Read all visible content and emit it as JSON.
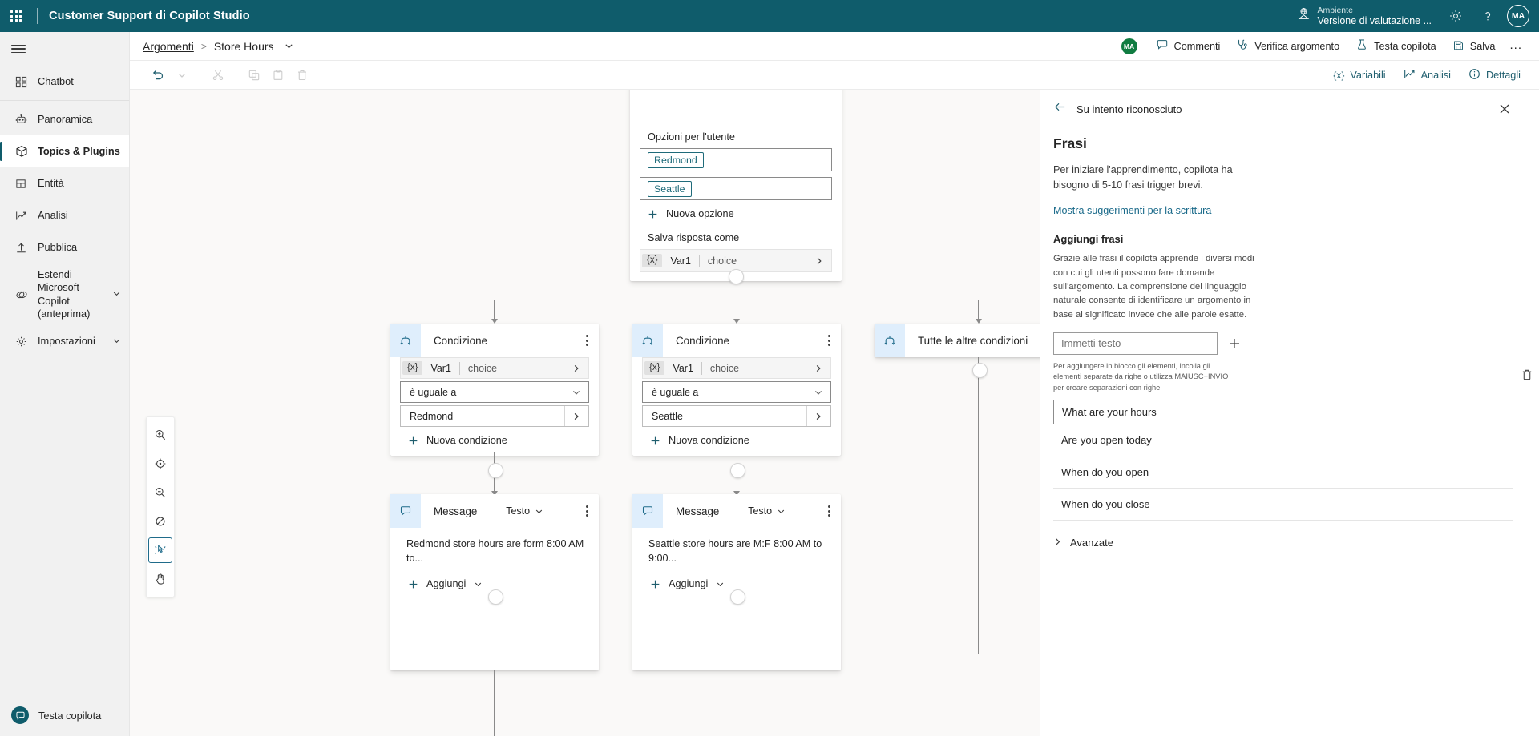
{
  "topbar": {
    "waffle_icon": "app-launcher-icon",
    "app_title": "Customer Support di Copilot Studio",
    "env_label": "Ambiente",
    "env_value": "Versione di valutazione ...",
    "env_icon": "environment-icon",
    "settings_icon": "gear-icon",
    "help_icon": "question-mark-icon",
    "avatar_initials": "MA"
  },
  "sidebar": {
    "hamburger_icon": "hamburger-menu-icon",
    "items": [
      {
        "label": "Chatbot",
        "icon": "grid-squares-icon",
        "selected": false
      },
      {
        "label": "Panoramica",
        "icon": "bot-icon",
        "selected": false
      },
      {
        "label": "Topics & Plugins",
        "icon": "box-icon",
        "selected": true
      },
      {
        "label": "Entità",
        "icon": "entity-grid-icon",
        "selected": false
      },
      {
        "label": "Analisi",
        "icon": "chart-line-icon",
        "selected": false
      },
      {
        "label": "Pubblica",
        "icon": "upload-icon",
        "selected": false
      },
      {
        "label": "Estendi Microsoft Copilot (anteprima)",
        "icon": "copilot-icon",
        "selected": false,
        "chevron": true
      },
      {
        "label": "Impostazioni",
        "icon": "gear-icon",
        "selected": false,
        "chevron": true
      }
    ],
    "bottom": {
      "label": "Testa copilota",
      "icon": "chat-bubble-icon"
    }
  },
  "breadcrumb": {
    "parent": "Argomenti",
    "separator": ">",
    "current": "Store Hours",
    "chevron_icon": "chevron-down-icon",
    "avatar_initials": "MA",
    "commands": [
      {
        "label": "Commenti",
        "icon": "comment-icon"
      },
      {
        "label": "Verifica argomento",
        "icon": "stethoscope-icon"
      },
      {
        "label": "Testa copilota",
        "icon": "flask-icon"
      },
      {
        "label": "Salva",
        "icon": "save-icon"
      }
    ],
    "overflow_label": "..."
  },
  "toolbar": {
    "left_buttons": [
      {
        "name": "undo-button",
        "icon": "undo-icon",
        "disabled": false
      },
      {
        "name": "redo-dropdown-button",
        "icon": "chevron-down-icon",
        "disabled": true
      },
      {
        "name": "cut-button",
        "icon": "scissors-icon",
        "disabled": true
      },
      {
        "name": "copy-button",
        "icon": "copy-icon",
        "disabled": true
      },
      {
        "name": "paste-button",
        "icon": "paste-icon",
        "disabled": true
      },
      {
        "name": "delete-button",
        "icon": "trash-icon",
        "disabled": true
      }
    ],
    "right_commands": [
      {
        "label": "Variabili",
        "icon": "variable-x-icon"
      },
      {
        "label": "Analisi",
        "icon": "chart-line-icon"
      },
      {
        "label": "Dettagli",
        "icon": "info-circle-icon"
      }
    ]
  },
  "canvas": {
    "question_node": {
      "options_label": "Opzioni per l'utente",
      "options": [
        "Redmond",
        "Seattle"
      ],
      "new_option_label": "Nuova opzione",
      "save_label": "Salva risposta come",
      "var_chip": "{x}",
      "var_name": "Var1",
      "var_type": "choice"
    },
    "conditions": [
      {
        "title": "Condizione",
        "var_chip": "{x}",
        "var_name": "Var1",
        "var_type": "choice",
        "operator": "è uguale a",
        "value": "Redmond",
        "new_condition_label": "Nuova condizione"
      },
      {
        "title": "Condizione",
        "var_chip": "{x}",
        "var_name": "Var1",
        "var_type": "choice",
        "operator": "è uguale a",
        "value": "Seattle",
        "new_condition_label": "Nuova condizione"
      }
    ],
    "all_other_conditions": {
      "title": "Tutte le altre condizioni",
      "icon": "condition-icon"
    },
    "messages": [
      {
        "title": "Message",
        "type_label": "Testo",
        "text": "Redmond store hours are form 8:00 AM to...",
        "add_label": "Aggiungi"
      },
      {
        "title": "Message",
        "type_label": "Testo",
        "text": "Seattle store hours are M:F 8:00 AM to 9:00...",
        "add_label": "Aggiungi"
      }
    ],
    "tools": [
      {
        "name": "zoom-in-button",
        "icon": "zoom-in-icon",
        "active": false
      },
      {
        "name": "fit-to-screen-button",
        "icon": "target-icon",
        "active": false
      },
      {
        "name": "zoom-out-button",
        "icon": "zoom-out-icon",
        "active": false
      },
      {
        "name": "hide-button",
        "icon": "eye-off-icon",
        "active": false
      },
      {
        "name": "pointer-tool-button",
        "icon": "cursor-icon",
        "active": true
      },
      {
        "name": "pan-tool-button",
        "icon": "hand-icon",
        "active": false
      }
    ]
  },
  "right_panel": {
    "back_label": "Su intento riconosciuto",
    "back_icon": "arrow-left-icon",
    "close_icon": "close-icon",
    "heading": "Frasi",
    "intro": "Per iniziare l'apprendimento, copilota ha bisogno di 5-10 frasi trigger brevi.",
    "suggestions_link": "Mostra suggerimenti per la scrittura",
    "add_heading": "Aggiungi frasi",
    "add_description": "Grazie alle frasi il copilota apprende i diversi modi con cui gli utenti possono fare domande sull'argomento. La comprensione del linguaggio naturale consente di identificare un argomento in base al significato invece che alle parole esatte.",
    "input_placeholder": "Immetti testo",
    "add_icon": "plus-icon",
    "bulk_hint": "Per aggiungere in blocco gli elementi, incolla gli elementi separate da righe o utilizza MAIUSC+INVIO per creare separazioni con righe",
    "delete_icon": "trash-icon",
    "phrases": [
      "What are your hours",
      "Are you open today",
      "When do you open",
      "When do you close"
    ],
    "advanced_label": "Avanzate",
    "advanced_icon": "chevron-right-icon"
  },
  "colors": {
    "brand_teal": "#0f5c6b",
    "accent_blue": "#1f6b8a",
    "node_icon_bg": "#dfeefc",
    "canvas_bg": "#faf9f8",
    "avatar_green": "#107c41"
  }
}
